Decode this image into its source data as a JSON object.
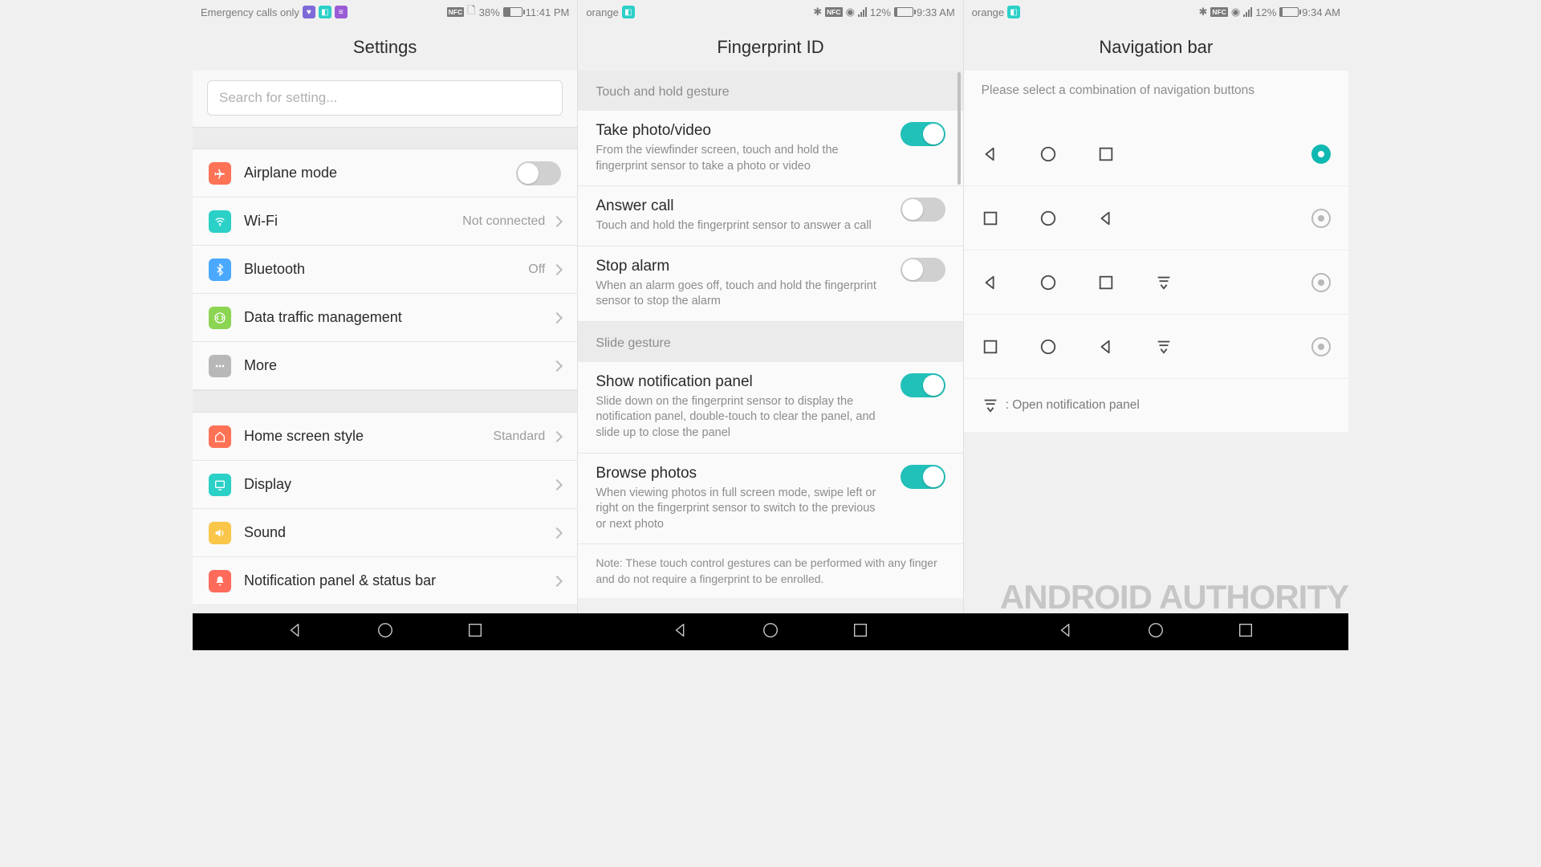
{
  "colors": {
    "accent": "#21c0b8",
    "iconOrange": "#fe7256",
    "iconTeal": "#2bd0c7",
    "iconBlue": "#4aa9ff",
    "iconGreen": "#8cd552",
    "iconGray": "#b8b8b8",
    "iconYellow": "#f9c64a",
    "iconRed": "#ff6b5b"
  },
  "watermark": "ANDROID AUTHORITY",
  "settings": {
    "status": {
      "carrier": "Emergency calls only",
      "battery": "38%",
      "time": "11:41 PM"
    },
    "title": "Settings",
    "search_placeholder": "Search for setting...",
    "group1": [
      {
        "key": "airplane",
        "label": "Airplane mode",
        "toggle": false
      },
      {
        "key": "wifi",
        "label": "Wi-Fi",
        "value": "Not connected"
      },
      {
        "key": "bt",
        "label": "Bluetooth",
        "value": "Off"
      },
      {
        "key": "data",
        "label": "Data traffic management"
      },
      {
        "key": "more",
        "label": "More"
      }
    ],
    "group2": [
      {
        "key": "home",
        "label": "Home screen style",
        "value": "Standard"
      },
      {
        "key": "display",
        "label": "Display"
      },
      {
        "key": "sound",
        "label": "Sound"
      },
      {
        "key": "notif",
        "label": "Notification panel & status bar"
      }
    ]
  },
  "fp": {
    "status": {
      "carrier": "orange",
      "battery": "12%",
      "time": "9:33 AM"
    },
    "title": "Fingerprint ID",
    "section1": "Touch and hold gesture",
    "items1": [
      {
        "title": "Take photo/video",
        "desc": "From the viewfinder screen, touch and hold the fingerprint sensor to take a photo or video",
        "on": true
      },
      {
        "title": "Answer call",
        "desc": "Touch and hold the fingerprint sensor to answer a call",
        "on": false
      },
      {
        "title": "Stop alarm",
        "desc": "When an alarm goes off, touch and hold the fingerprint sensor to stop the alarm",
        "on": false
      }
    ],
    "section2": "Slide gesture",
    "items2": [
      {
        "title": "Show notification panel",
        "desc": "Slide down on the fingerprint sensor to display the notification panel, double-touch to clear the panel, and slide up to close the panel",
        "on": true
      },
      {
        "title": "Browse photos",
        "desc": "When viewing photos in full screen mode, swipe left or right on the fingerprint sensor to switch to the previous or next photo",
        "on": true
      }
    ],
    "note": "Note: These touch control gestures can be performed with any finger and do not require a fingerprint to be enrolled."
  },
  "nav": {
    "status": {
      "carrier": "orange",
      "battery": "12%",
      "time": "9:34 AM"
    },
    "title": "Navigation bar",
    "prompt": "Please select a combination of navigation buttons",
    "rows": [
      {
        "icons": [
          "back",
          "home",
          "recent"
        ],
        "selected": true
      },
      {
        "icons": [
          "recent",
          "home",
          "back"
        ],
        "selected": false
      },
      {
        "icons": [
          "back",
          "home",
          "recent",
          "notif"
        ],
        "selected": false
      },
      {
        "icons": [
          "recent",
          "home",
          "back",
          "notif"
        ],
        "selected": false
      }
    ],
    "legend": ": Open notification panel"
  },
  "status_icons": {
    "nfc": "NFC"
  }
}
